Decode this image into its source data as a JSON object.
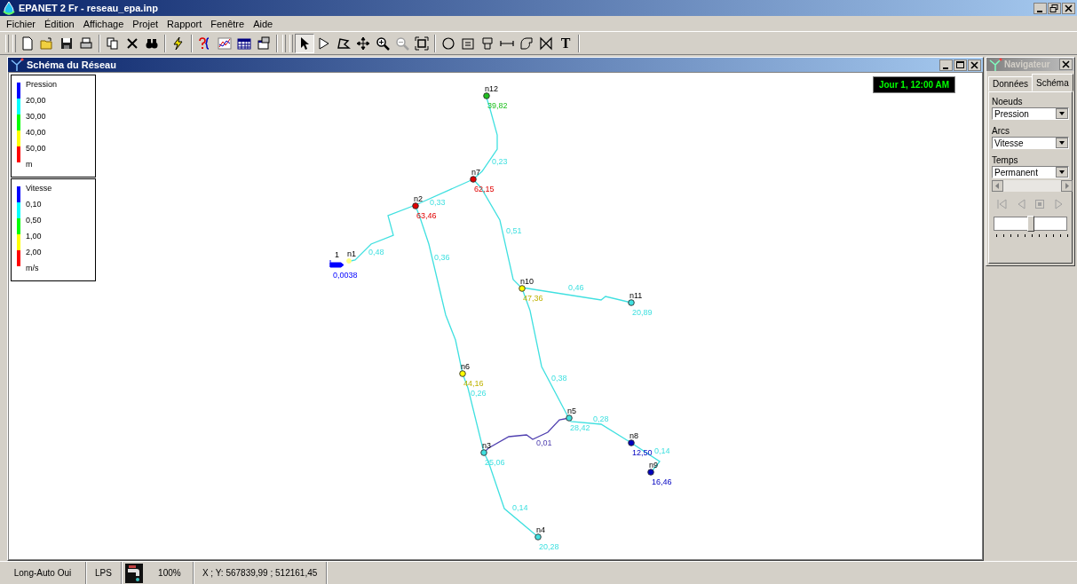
{
  "window": {
    "title": "EPANET 2 Fr - reseau_epa.inp"
  },
  "menu": [
    {
      "label": "Fichier"
    },
    {
      "label": "Édition"
    },
    {
      "label": "Affichage"
    },
    {
      "label": "Projet"
    },
    {
      "label": "Rapport"
    },
    {
      "label": "Fenêtre"
    },
    {
      "label": "Aide"
    }
  ],
  "toolbar": {
    "map_tools": [
      {
        "selected": true
      },
      {
        "selected": false
      },
      {
        "selected": false
      },
      {
        "selected": false
      },
      {
        "selected": false
      },
      {
        "selected": false
      },
      {
        "selected": false
      }
    ],
    "text_tool": "T"
  },
  "map_window": {
    "title": "Schéma du Réseau",
    "clock": "Jour 1, 12:00 AM",
    "legends": [
      {
        "title": "Pression",
        "unit": "m",
        "levels": [
          {
            "color": "#0000ff"
          },
          {
            "color": "#00ffff"
          },
          {
            "color": "#00ff00"
          },
          {
            "color": "#ffff00"
          },
          {
            "color": "#ff0000"
          }
        ],
        "breaks": [
          "20,00",
          "30,00",
          "40,00",
          "50,00"
        ]
      },
      {
        "title": "Vitesse",
        "unit": "m/s",
        "levels": [
          {
            "color": "#0000ff"
          },
          {
            "color": "#00ffff"
          },
          {
            "color": "#00ff00"
          },
          {
            "color": "#ffff00"
          },
          {
            "color": "#ff0000"
          }
        ],
        "breaks": [
          "0,10",
          "0,50",
          "1,00",
          "2,00"
        ]
      }
    ],
    "reservoir": {
      "label": "1",
      "value": "0,0038",
      "color": "#0000ff"
    },
    "nodes": [
      {
        "label": "n1",
        "color": "#ffff80"
      },
      {
        "label": "n2",
        "value": "63,46",
        "color": "#e00000"
      },
      {
        "label": "n3",
        "value": "25,06",
        "color": "#40e0e0"
      },
      {
        "label": "n4",
        "value": "20,28",
        "color": "#40e0e0"
      },
      {
        "label": "n5",
        "value": "28,42",
        "color": "#40e0e0"
      },
      {
        "label": "n6",
        "value": "44,16",
        "color": "#ffff00"
      },
      {
        "label": "n7",
        "value": "62,15",
        "color": "#e00000"
      },
      {
        "label": "n8",
        "value": "12,50",
        "color": "#0000c0"
      },
      {
        "label": "n9",
        "value": "16,46",
        "color": "#0000c0"
      },
      {
        "label": "n10",
        "value": "47,36",
        "color": "#ffff00"
      },
      {
        "label": "n11",
        "value": "20,89",
        "color": "#40e0e0"
      },
      {
        "label": "n12",
        "value": "39,82",
        "color": "#20c020"
      }
    ],
    "links": [
      {
        "value": "0,48",
        "color": "#40e0e0"
      },
      {
        "value": "0,33",
        "color": "#40e0e0"
      },
      {
        "value": "0,23",
        "color": "#40e0e0"
      },
      {
        "value": "0,51",
        "color": "#40e0e0"
      },
      {
        "value": "0,36",
        "color": "#40e0e0"
      },
      {
        "value": "0,46",
        "color": "#40e0e0"
      },
      {
        "value": "0,38",
        "color": "#40e0e0"
      },
      {
        "value": "0,26",
        "color": "#40e0e0"
      },
      {
        "value": "0,01",
        "color": "#5040b0"
      },
      {
        "value": "0,28",
        "color": "#40e0e0"
      },
      {
        "value": "0,14",
        "color": "#40e0e0"
      },
      {
        "value": "0,14",
        "color": "#40e0e0"
      }
    ]
  },
  "navigator": {
    "title": "Navigateur",
    "tabs": [
      {
        "label": "Données",
        "selected": false
      },
      {
        "label": "Schéma",
        "selected": true
      }
    ],
    "fields": [
      {
        "label": "Noeuds",
        "value": "Pression"
      },
      {
        "label": "Arcs",
        "value": "Vitesse"
      },
      {
        "label": "Temps",
        "value": "Permanent"
      }
    ],
    "playback_disabled": true,
    "speed": {
      "level": 0.5
    }
  },
  "status_bar": [
    {
      "kind": "text",
      "text": "Long-Auto Oui"
    },
    {
      "kind": "text",
      "text": "LPS"
    },
    {
      "kind": "icon"
    },
    {
      "kind": "text",
      "text": "100%"
    },
    {
      "kind": "text",
      "text": "X ; Y: 567839,99 ; 512161,45"
    }
  ]
}
